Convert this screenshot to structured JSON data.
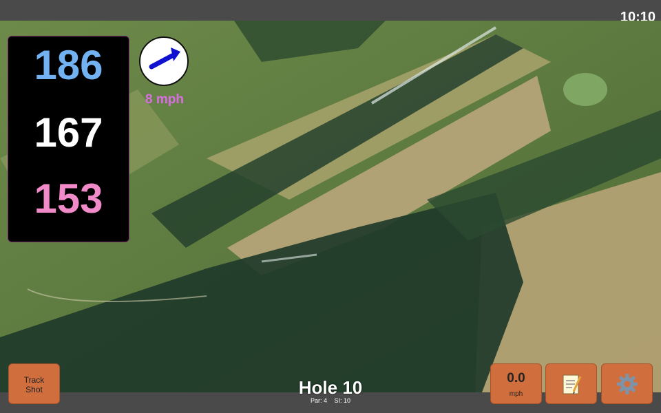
{
  "status": {
    "time": "10:10"
  },
  "distances": {
    "back": "186",
    "middle": "167",
    "front": "153"
  },
  "wind": {
    "speed_label": "8 mph",
    "icon": "wind-arrow-icon"
  },
  "hole": {
    "title": "Hole 10",
    "par": "Par: 4",
    "si": "SI: 10"
  },
  "buttons": {
    "track_shot": {
      "line1": "Track",
      "line2": "Shot"
    },
    "speed": {
      "value": "0.0",
      "unit": "mph"
    },
    "notes": {
      "icon": "notepad-icon"
    },
    "settings": {
      "icon": "gear-icon"
    }
  },
  "colors": {
    "back_distance": "#73b2f2",
    "middle_distance": "#ffffff",
    "front_distance": "#f08ac8",
    "wind_text": "#d86fe0",
    "button": "#d16e3d"
  }
}
